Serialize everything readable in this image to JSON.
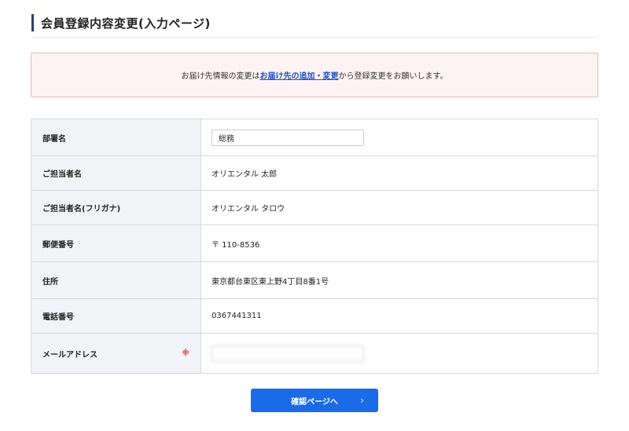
{
  "page": {
    "title": "会員登録内容変更(入力ページ)"
  },
  "notice": {
    "prefix": "お届け先情報の変更は",
    "link_text": "お届け先の追加・変更",
    "suffix": "から登録変更をお願いします。"
  },
  "form": {
    "rows": [
      {
        "label": "部署名",
        "value": "総務",
        "type": "input"
      },
      {
        "label": "ご担当者名",
        "value": "オリエンタル 太郎",
        "type": "text"
      },
      {
        "label": "ご担当者名(フリガナ)",
        "value": "オリエンタル タロウ",
        "type": "text"
      },
      {
        "label": "郵便番号",
        "value": "〒 110-8536",
        "type": "text"
      },
      {
        "label": "住所",
        "value": "東京都台東区東上野4丁目8番1号",
        "type": "text"
      },
      {
        "label": "電話番号",
        "value": "0367441311",
        "type": "text"
      },
      {
        "label": "メールアドレス",
        "required_mark": "※",
        "value": "",
        "type": "input",
        "blurred": true
      }
    ]
  },
  "submit": {
    "label": "確認ページへ",
    "icon": "chevron-right-icon"
  },
  "colors": {
    "accent": "#1b6ae8",
    "title_bar": "#27416b",
    "notice_bg": "#fdf3f3",
    "notice_border": "#e9b6b6",
    "link": "#1f4fc8",
    "required": "#e0383e",
    "label_bg": "#f1f3f6"
  }
}
